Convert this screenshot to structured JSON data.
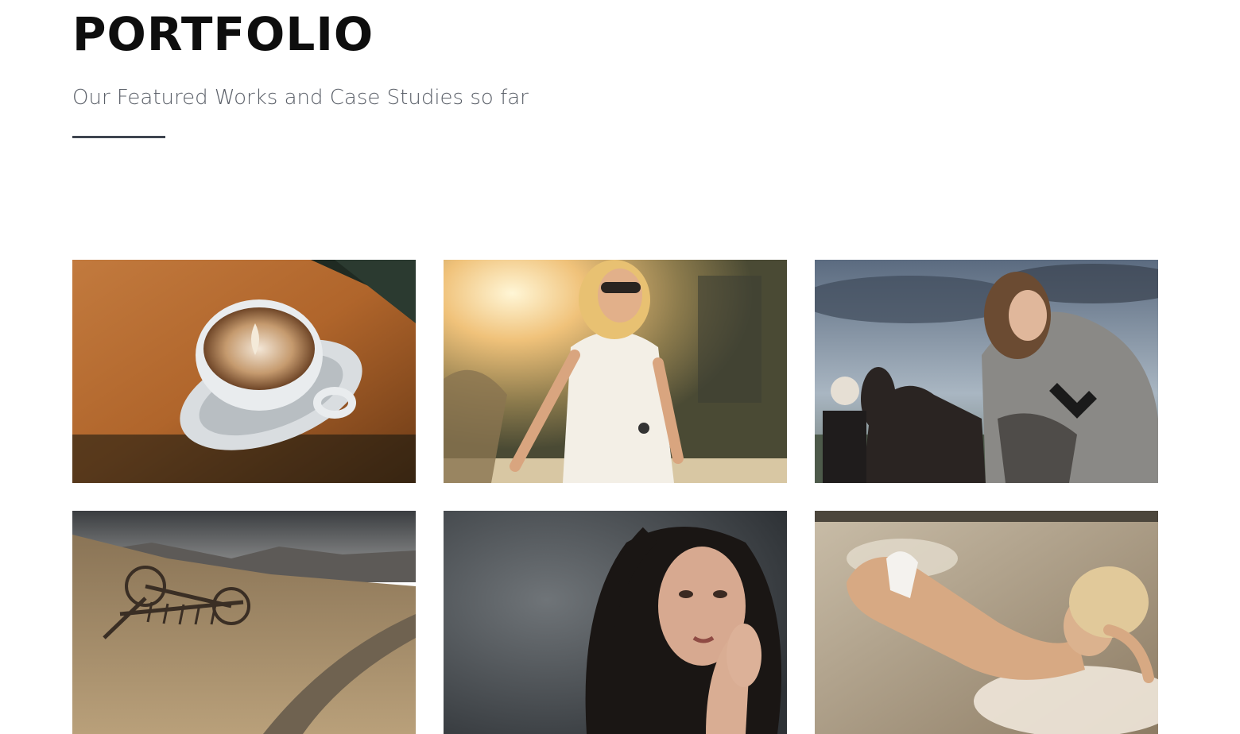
{
  "section": {
    "title": "PORTFOLIO",
    "subtitle": "Our Featured Works and Case Studies so far"
  },
  "colors": {
    "title": "#0e0e0e",
    "subtitle": "#5b6069",
    "divider": "#3f4550"
  },
  "portfolio": {
    "items": [
      {
        "subject": "latte-art-coffee-cup"
      },
      {
        "subject": "woman-in-sunlight-white-dress"
      },
      {
        "subject": "woman-in-fur-coat-with-horse"
      },
      {
        "subject": "hay-rake-in-field"
      },
      {
        "subject": "woman-dark-hair-portrait"
      },
      {
        "subject": "woman-lying-on-fur"
      }
    ]
  }
}
